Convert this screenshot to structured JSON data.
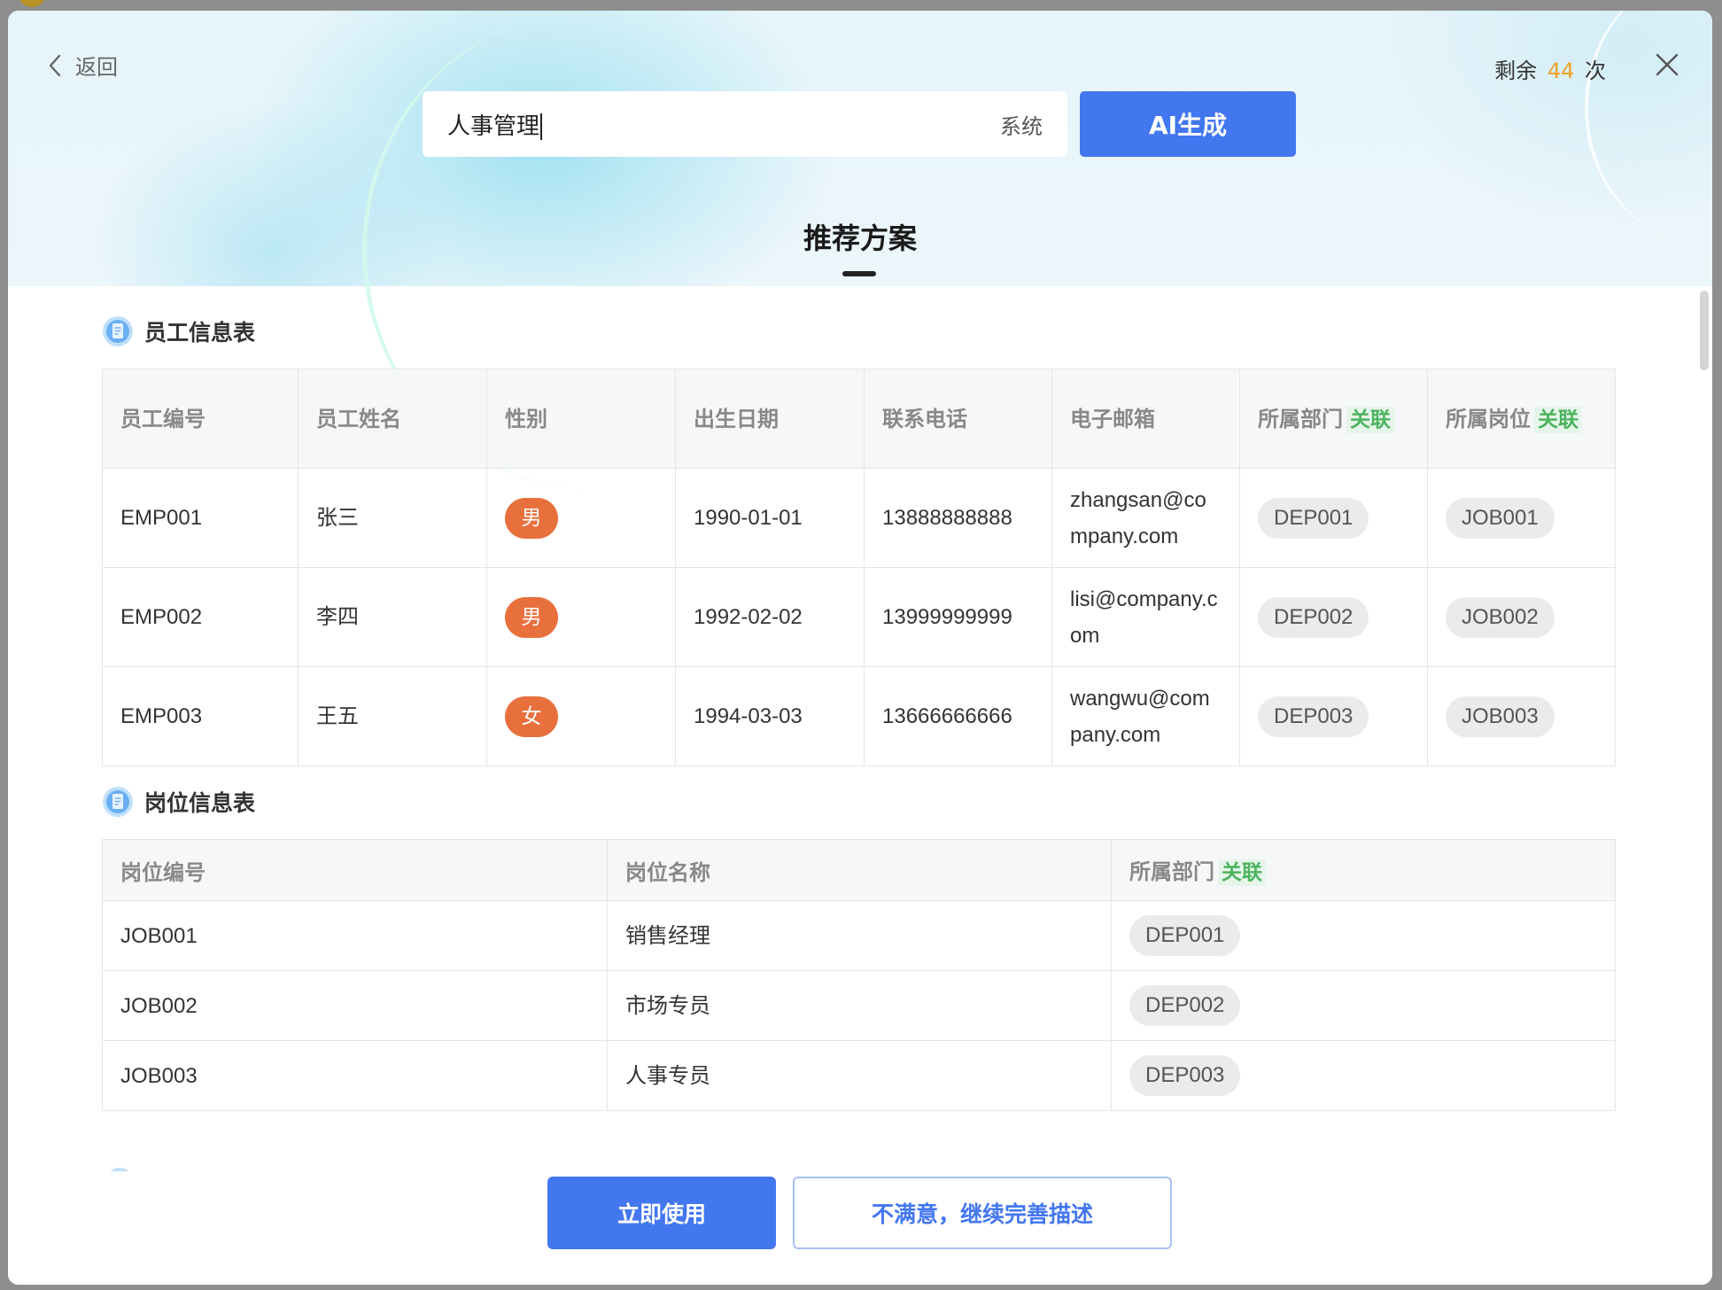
{
  "header": {
    "back_label": "返回",
    "remaining_prefix": "剩余",
    "remaining_count": "44",
    "remaining_suffix": "次"
  },
  "search": {
    "value": "人事管理",
    "suffix": "系统",
    "button_label": "AI生成"
  },
  "recommend": {
    "title": "推荐方案"
  },
  "tables": [
    {
      "title": "员工信息表",
      "columns": [
        {
          "label": "员工编号",
          "relation": ""
        },
        {
          "label": "员工姓名",
          "relation": ""
        },
        {
          "label": "性别",
          "relation": ""
        },
        {
          "label": "出生日期",
          "relation": ""
        },
        {
          "label": "联系电话",
          "relation": ""
        },
        {
          "label": "电子邮箱",
          "relation": ""
        },
        {
          "label": "所属部门",
          "relation": "关联"
        },
        {
          "label": "所属岗位",
          "relation": "关联"
        }
      ],
      "rows": [
        {
          "id": "EMP001",
          "name": "张三",
          "gender": "男",
          "birth": "1990-01-01",
          "phone": "13888888888",
          "email": "zhangsan@company.com",
          "dept": "DEP001",
          "job": "JOB001"
        },
        {
          "id": "EMP002",
          "name": "李四",
          "gender": "男",
          "birth": "1992-02-02",
          "phone": "13999999999",
          "email": "lisi@company.com",
          "dept": "DEP002",
          "job": "JOB002"
        },
        {
          "id": "EMP003",
          "name": "王五",
          "gender": "女",
          "birth": "1994-03-03",
          "phone": "13666666666",
          "email": "wangwu@company.com",
          "dept": "DEP003",
          "job": "JOB003"
        }
      ]
    },
    {
      "title": "岗位信息表",
      "columns": [
        {
          "label": "岗位编号",
          "relation": ""
        },
        {
          "label": "岗位名称",
          "relation": ""
        },
        {
          "label": "所属部门",
          "relation": "关联"
        }
      ],
      "rows": [
        {
          "id": "JOB001",
          "name": "销售经理",
          "dept": "DEP001"
        },
        {
          "id": "JOB002",
          "name": "市场专员",
          "dept": "DEP002"
        },
        {
          "id": "JOB003",
          "name": "人事专员",
          "dept": "DEP003"
        }
      ]
    }
  ],
  "footer": {
    "use_label": "立即使用",
    "refine_label": "不满意，继续完善描述"
  },
  "colors": {
    "primary": "#4377f0",
    "accent_count": "#f0a029",
    "gender_badge": "#e8703d",
    "relation_tag": "#4cb35e"
  },
  "icons": [
    "chevron-left-icon",
    "close-icon",
    "document-icon"
  ]
}
